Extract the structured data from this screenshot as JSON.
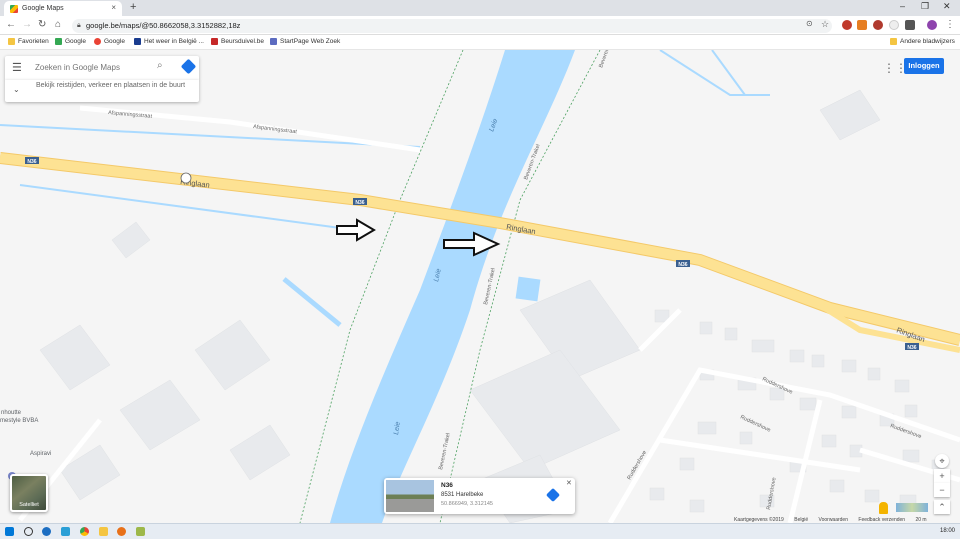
{
  "browser": {
    "tab_title": "Google Maps",
    "tab_close": "×",
    "new_tab": "+",
    "url": "google.be/maps/@50.8662058,3.3152882,18z",
    "window_controls": [
      "–",
      "❐",
      "✕"
    ]
  },
  "bookmarks": [
    {
      "label": "Favorieten",
      "color": "#f4c542"
    },
    {
      "label": "Google",
      "color": "#4285f4"
    },
    {
      "label": "Google",
      "color": "#ea4335"
    },
    {
      "label": "Het weer in België ...",
      "color": "#1a3c8f"
    },
    {
      "label": "Beursduivel.be",
      "color": "#c62828"
    },
    {
      "label": "StartPage Web Zoek",
      "color": "#5c6bc0"
    }
  ],
  "other_bookmarks": "Andere bladwijzers",
  "maps": {
    "search_placeholder": "Zoeken in Google Maps",
    "suggestion_text": "Bekijk reistijden, verkeer en plaatsen in de buurt",
    "signin_label": "Inloggen",
    "satellite_label": "Satelliet",
    "labels": {
      "n36_1": "N36",
      "n36_2": "N36",
      "n36_3": "N36",
      "n36_4": "N36",
      "ringlaan_1": "Ringlaan",
      "ringlaan_2": "Ringlaan",
      "ringlaan_3": "Ringlaan",
      "afspanningsstraat_1": "Afspanningsstraat",
      "afspanningsstraat_2": "Afspanningsstraat",
      "leie_1": "Leie",
      "leie_2": "Leie",
      "leie_3": "Leie",
      "bevererentrakel_1": "Beveren-Trakel",
      "bevererentrakel_2": "Beveren-Trakel",
      "bevererentrakel_3": "Beveren-Trakel",
      "beveren_top": "Beveren",
      "ruddershove_1": "Ruddershove",
      "ruddershove_2": "Ruddershove",
      "ruddershove_3": "Ruddershove",
      "ruddershove_4": "Ruddershove",
      "ruddershove_5": "Ruddershove",
      "business": "nhoutte\nmestyle BVBA",
      "aspiravi": "Aspiravi"
    },
    "streetview_card": {
      "title": "N36",
      "address": "8531 Harelbeke",
      "coords": "50.866949, 3.312145",
      "close": "✕"
    },
    "controls": {
      "zoom_in": "+",
      "zoom_out": "−",
      "locate": "⌖",
      "expand": "⌃"
    },
    "footer": [
      "Kaartgegevens ©2019",
      "België",
      "Voorwaarden",
      "Feedback verzenden",
      "20 m"
    ]
  },
  "taskbar": {
    "clock": "18:00"
  },
  "colors": {
    "water": "#aadaff",
    "road_major": "#fde293",
    "road_outline": "#f4c969",
    "accent": "#1a73e8",
    "building": "#e8eaed"
  }
}
